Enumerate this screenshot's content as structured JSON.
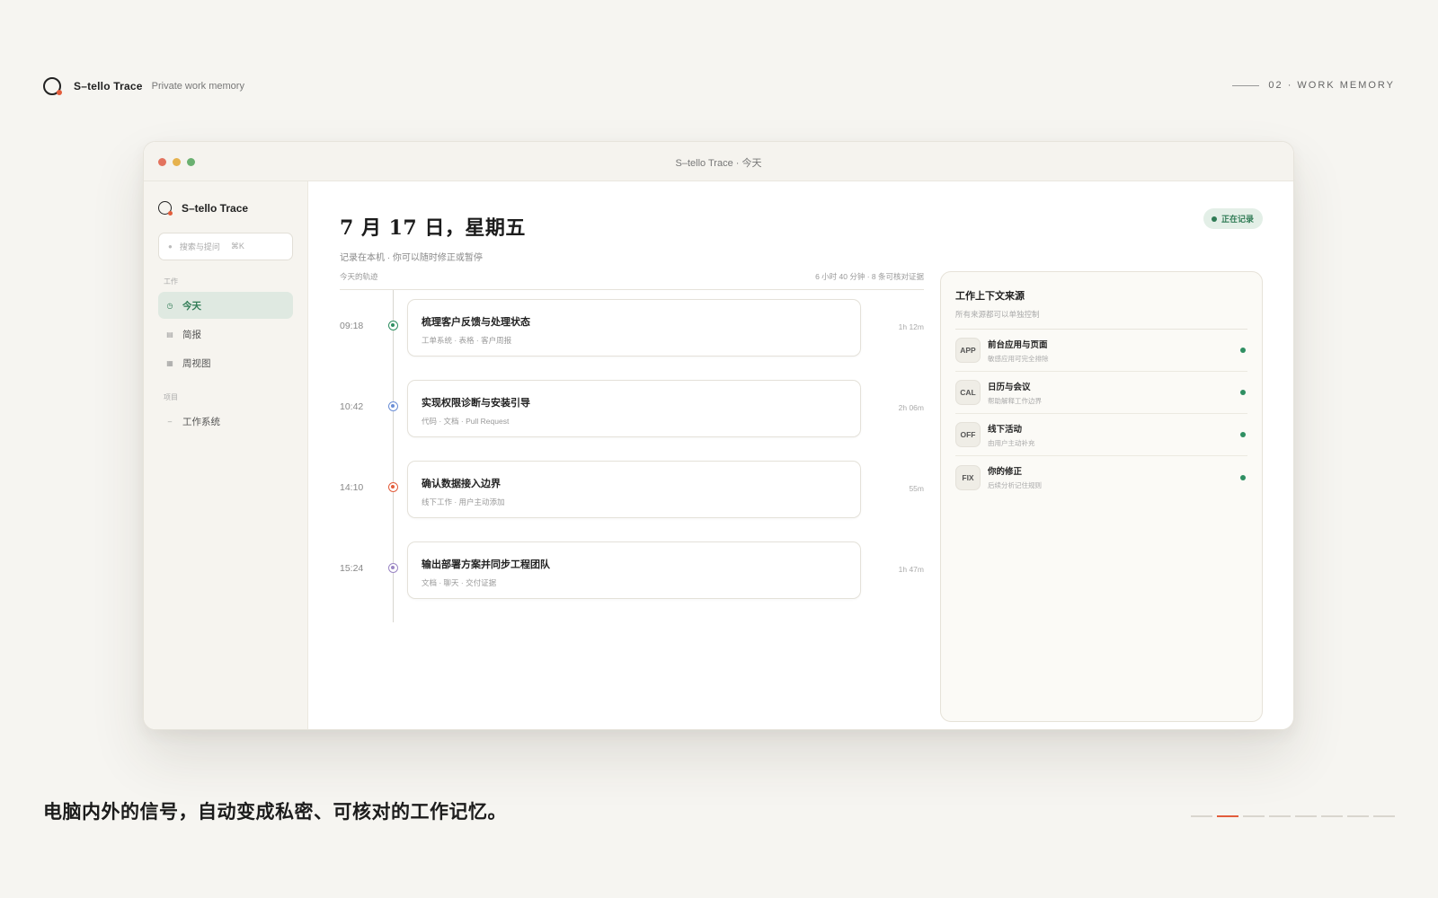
{
  "header": {
    "brand_name": "S–tello Trace",
    "brand_tagline": "Private work memory",
    "section_label": "02 · WORK MEMORY"
  },
  "window": {
    "title": "S–tello Trace · 今天"
  },
  "sidebar": {
    "brand_name": "S–tello Trace",
    "search": {
      "placeholder": "搜索与提问",
      "shortcut": "⌘K"
    },
    "group_work": "工作",
    "items": [
      {
        "label": "今天",
        "icon": "clock-icon",
        "active": true
      },
      {
        "label": "简报",
        "icon": "grid-icon",
        "active": false
      },
      {
        "label": "周视图",
        "icon": "calendar-icon",
        "active": false
      }
    ],
    "group_projects": "项目",
    "project_items": [
      {
        "label": "工作系统",
        "icon": "dash-icon"
      }
    ]
  },
  "main": {
    "date_title": "7 月 17 日，星期五",
    "date_subtitle": "记录在本机 · 你可以随时修正或暂停",
    "recording_badge": "正在记录",
    "timeline": {
      "heading": "今天的轨迹",
      "summary": "6 小时 40 分钟 · 8 条可核对证据",
      "entries": [
        {
          "time": "09:18",
          "title": "梳理客户反馈与处理状态",
          "meta": "工单系统 · 表格 · 客户周报",
          "duration": "1h 12m",
          "color": "#2f8f62"
        },
        {
          "time": "10:42",
          "title": "实现权限诊断与安装引导",
          "meta": "代码 · 文档 · Pull Request",
          "duration": "2h 06m",
          "color": "#6b8fd6"
        },
        {
          "time": "14:10",
          "title": "确认数据接入边界",
          "meta": "线下工作 · 用户主动添加",
          "duration": "55m",
          "color": "#e25d3c"
        },
        {
          "time": "15:24",
          "title": "输出部署方案并同步工程团队",
          "meta": "文档 · 聊天 · 交付证据",
          "duration": "1h 47m",
          "color": "#9b86c4"
        }
      ]
    }
  },
  "panel": {
    "title": "工作上下文来源",
    "subtitle": "所有来源都可以单独控制",
    "sources": [
      {
        "tag": "APP",
        "title": "前台应用与页面",
        "desc": "敏感应用可完全排除"
      },
      {
        "tag": "CAL",
        "title": "日历与会议",
        "desc": "帮助解释工作边界"
      },
      {
        "tag": "OFF",
        "title": "线下活动",
        "desc": "由用户主动补充"
      },
      {
        "tag": "FIX",
        "title": "你的修正",
        "desc": "后续分析记住规则"
      }
    ]
  },
  "footer": {
    "caption": "电脑内外的信号，自动变成私密、可核对的工作记忆。",
    "pager_total": 8,
    "pager_current": 2
  }
}
